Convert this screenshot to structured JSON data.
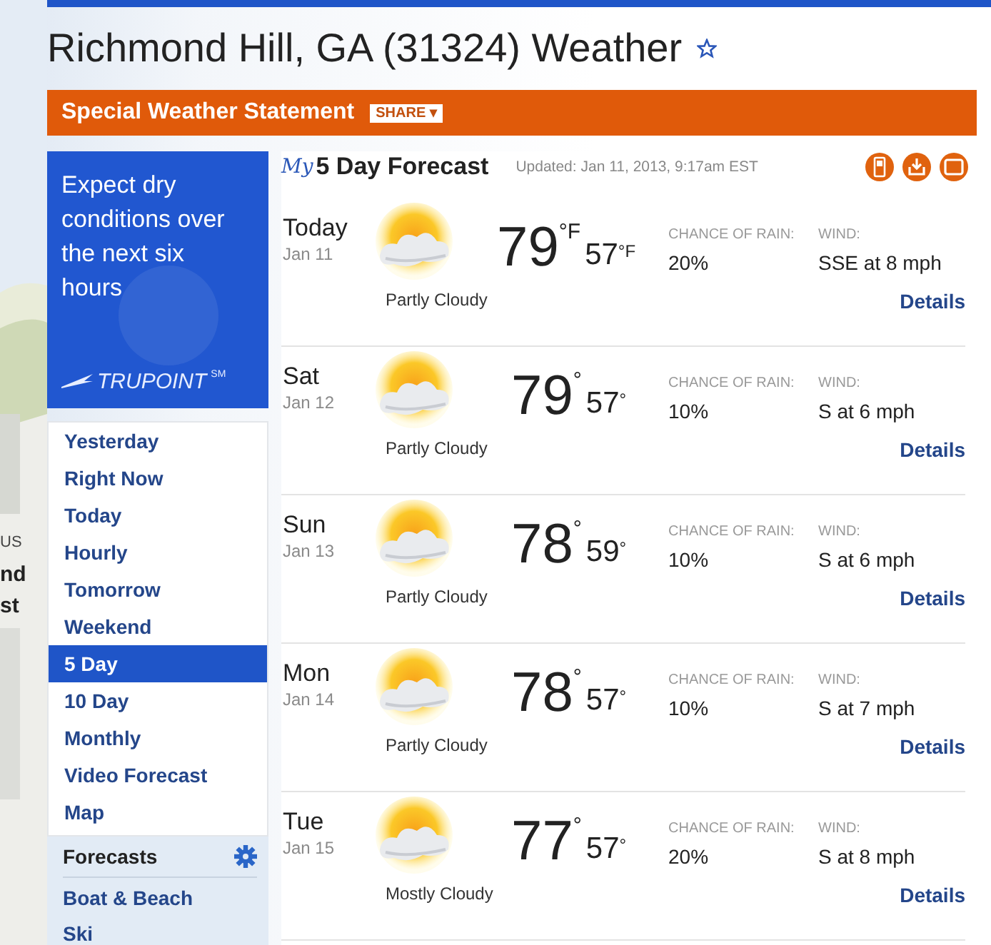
{
  "page_title": "Richmond Hill, GA (31324) Weather",
  "alert": {
    "title": "Special Weather Statement",
    "share": "SHARE ▾"
  },
  "promo": {
    "text": "Expect dry conditions over the next six hours",
    "logo": "TRUPOINT",
    "logo_mark": "SM"
  },
  "nav": [
    {
      "label": "Yesterday",
      "selected": false
    },
    {
      "label": "Right Now",
      "selected": false
    },
    {
      "label": "Today",
      "selected": false
    },
    {
      "label": "Hourly",
      "selected": false
    },
    {
      "label": "Tomorrow",
      "selected": false
    },
    {
      "label": "Weekend",
      "selected": false
    },
    {
      "label": "5 Day",
      "selected": true
    },
    {
      "label": "10 Day",
      "selected": false
    },
    {
      "label": "Monthly",
      "selected": false
    },
    {
      "label": "Video Forecast",
      "selected": false
    },
    {
      "label": "Map",
      "selected": false
    }
  ],
  "forecasts_panel": {
    "title": "Forecasts",
    "items": [
      "Boat & Beach",
      "Ski"
    ]
  },
  "side_fragments": [
    "US",
    "nd",
    "st"
  ],
  "forecast": {
    "my": "My",
    "title": "5 Day Forecast",
    "updated": "Updated: Jan 11, 2013, 9:17am EST",
    "days": [
      {
        "day": "Today",
        "date": "Jan 11",
        "condition": "Partly Cloudy",
        "high": "79",
        "high_unit": "°F",
        "low": "57",
        "low_unit": "°F",
        "rain_label": "CHANCE OF RAIN:",
        "rain": "20%",
        "wind_label": "WIND:",
        "wind": "SSE at 8 mph",
        "details": "Details"
      },
      {
        "day": "Sat",
        "date": "Jan 12",
        "condition": "Partly Cloudy",
        "high": "79",
        "high_unit": "°",
        "low": "57",
        "low_unit": "°",
        "rain_label": "CHANCE OF RAIN:",
        "rain": "10%",
        "wind_label": "WIND:",
        "wind": "S at 6 mph",
        "details": "Details"
      },
      {
        "day": "Sun",
        "date": "Jan 13",
        "condition": "Partly Cloudy",
        "high": "78",
        "high_unit": "°",
        "low": "59",
        "low_unit": "°",
        "rain_label": "CHANCE OF RAIN:",
        "rain": "10%",
        "wind_label": "WIND:",
        "wind": "S at 6 mph",
        "details": "Details"
      },
      {
        "day": "Mon",
        "date": "Jan 14",
        "condition": "Partly Cloudy",
        "high": "78",
        "high_unit": "°",
        "low": "57",
        "low_unit": "°",
        "rain_label": "CHANCE OF RAIN:",
        "rain": "10%",
        "wind_label": "WIND:",
        "wind": "S at 7 mph",
        "details": "Details"
      },
      {
        "day": "Tue",
        "date": "Jan 15",
        "condition": "Mostly Cloudy",
        "high": "77",
        "high_unit": "°",
        "low": "57",
        "low_unit": "°",
        "rain_label": "CHANCE OF RAIN:",
        "rain": "20%",
        "wind_label": "WIND:",
        "wind": "S at 8 mph",
        "details": "Details"
      }
    ]
  }
}
